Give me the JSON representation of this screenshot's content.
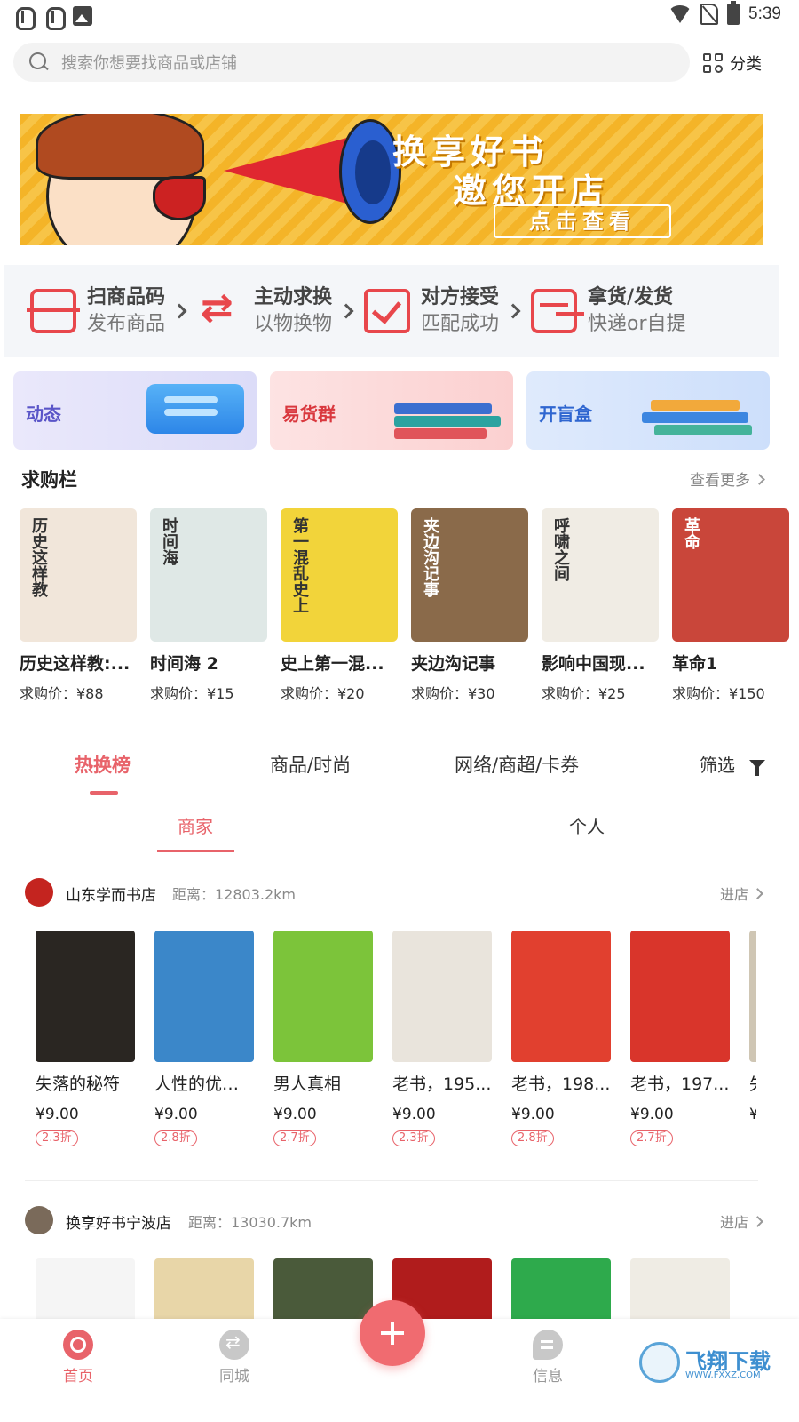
{
  "status_bar": {
    "time": "5:39",
    "icons": [
      "bug-icon",
      "bug-icon",
      "image-icon",
      "wifi-icon",
      "no-sim-icon",
      "battery-icon"
    ]
  },
  "search": {
    "placeholder": "搜索你想要找商品或店铺",
    "category_label": "分类"
  },
  "banner": {
    "title_line1": "换享好书",
    "title_line2": "邀您开店",
    "button": "点击查看"
  },
  "steps": [
    {
      "title": "扫商品码",
      "subtitle": "发布商品",
      "icon": "scan-icon"
    },
    {
      "title": "主动求换",
      "subtitle": "以物换物",
      "icon": "swap-icon"
    },
    {
      "title": "对方接受",
      "subtitle": "匹配成功",
      "icon": "check-icon"
    },
    {
      "title": "拿货/发货",
      "subtitle": "快递or自提",
      "icon": "package-icon"
    }
  ],
  "cards": [
    {
      "label": "动态"
    },
    {
      "label": "易货群"
    },
    {
      "label": "开盲盒"
    }
  ],
  "wanted": {
    "title": "求购栏",
    "more": "查看更多",
    "items": [
      {
        "name": "历史这样教:...",
        "price": "求购价：¥88",
        "cover_text": "历史这样教",
        "color": "#f1e6da"
      },
      {
        "name": "时间海 2",
        "price": "求购价：¥15",
        "cover_text": "时间海",
        "color": "#dfe8e6"
      },
      {
        "name": "史上第一混...",
        "price": "求购价：¥20",
        "cover_text": "第一混乱史上",
        "color": "#f2d43a"
      },
      {
        "name": "夹边沟记事",
        "price": "求购价：¥30",
        "cover_text": "夹边沟记事",
        "color": "#8a6a4a"
      },
      {
        "name": "影响中国现...",
        "price": "求购价：¥25",
        "cover_text": "呼啸之间",
        "color": "#f0ece4"
      },
      {
        "name": "革命1",
        "price": "求购价：¥150",
        "cover_text": "革命",
        "color": "#c9463a"
      }
    ]
  },
  "main_tabs": [
    {
      "label": "热换榜",
      "active": true
    },
    {
      "label": "商品/时尚",
      "active": false
    },
    {
      "label": "网络/商超/卡券",
      "active": false
    }
  ],
  "filter_label": "筛选",
  "sub_tabs": [
    {
      "label": "商家",
      "active": true
    },
    {
      "label": "个人",
      "active": false
    }
  ],
  "shops": [
    {
      "name": "山东学而书店",
      "distance": "距离：12803.2km",
      "enter": "进店",
      "avatar_color": "#c4241f",
      "goods": [
        {
          "name": "失落的秘符",
          "price": "¥9.00",
          "discount": "2.3折",
          "cover_color": "#2a2622"
        },
        {
          "name": "人性的优点...",
          "price": "¥9.00",
          "discount": "2.8折",
          "cover_color": "#3b87c9"
        },
        {
          "name": "男人真相",
          "price": "¥9.00",
          "discount": "2.7折",
          "cover_color": "#7cc43a"
        },
        {
          "name": "老书，195...",
          "price": "¥9.00",
          "discount": "2.3折",
          "cover_color": "#e9e4dc"
        },
        {
          "name": "老书，198...",
          "price": "¥9.00",
          "discount": "2.8折",
          "cover_color": "#e1402f"
        },
        {
          "name": "老书，197...",
          "price": "¥9.00",
          "discount": "2.7折",
          "cover_color": "#d9352b"
        },
        {
          "name": "失",
          "price": "¥",
          "discount": "",
          "cover_color": "#cfc6b4"
        }
      ]
    },
    {
      "name": "换享好书宁波店",
      "distance": "距离：13030.7km",
      "enter": "进店",
      "avatar_color": "#7a6a5a",
      "goods": [
        {
          "name": "",
          "price": "",
          "discount": "",
          "cover_color": "#f5f5f5"
        },
        {
          "name": "",
          "price": "",
          "discount": "",
          "cover_color": "#e8d6a8"
        },
        {
          "name": "",
          "price": "",
          "discount": "",
          "cover_color": "#4a5a3a"
        },
        {
          "name": "",
          "price": "",
          "discount": "",
          "cover_color": "#b01c1c"
        },
        {
          "name": "",
          "price": "",
          "discount": "",
          "cover_color": "#2eaa4c"
        },
        {
          "name": "",
          "price": "",
          "discount": "",
          "cover_color": "#efece4"
        }
      ]
    }
  ],
  "bottom_nav": [
    {
      "label": "首页",
      "active": true,
      "icon": "home-icon"
    },
    {
      "label": "同城",
      "active": false,
      "icon": "city-icon"
    },
    {
      "label": "信息",
      "active": false,
      "icon": "message-icon"
    }
  ],
  "watermark": {
    "text": "飞翔下载",
    "url": "WWW.FXXZ.COM"
  },
  "colors": {
    "accent": "#e8636a",
    "banner": "#f4b428",
    "step_icon": "#e8474c"
  }
}
